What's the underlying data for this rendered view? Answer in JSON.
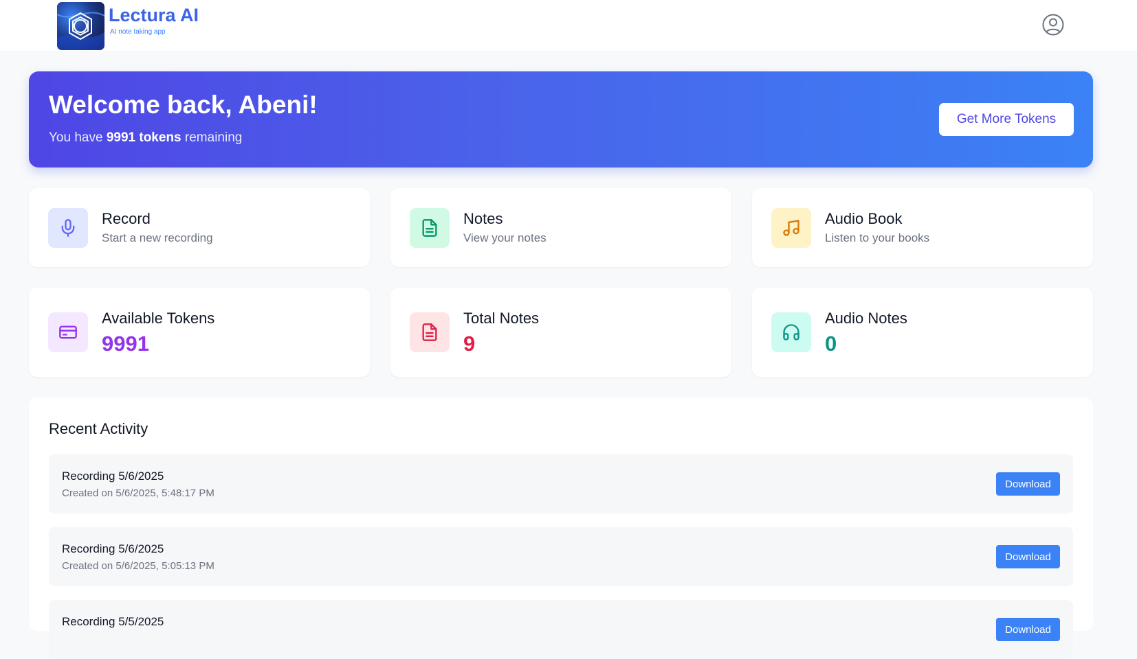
{
  "brand": {
    "name": "Lectura AI",
    "tagline": "AI note taking app"
  },
  "hero": {
    "title": "Welcome back, Abeni!",
    "sub_prefix": "You have ",
    "tokens_bold": "9991 tokens",
    "sub_suffix": " remaining",
    "button": "Get More Tokens"
  },
  "actions": [
    {
      "title": "Record",
      "subtitle": "Start a new recording",
      "icon": "microphone-icon",
      "color": "#6366f1",
      "bg": "#e0e7ff"
    },
    {
      "title": "Notes",
      "subtitle": "View your notes",
      "icon": "document-icon",
      "color": "#059669",
      "bg": "#d1fae5"
    },
    {
      "title": "Audio Book",
      "subtitle": "Listen to your books",
      "icon": "music-note-icon",
      "color": "#d97706",
      "bg": "#fef3c7"
    }
  ],
  "stats": [
    {
      "title": "Available Tokens",
      "value": "9991",
      "icon": "credit-card-icon",
      "color": "#9333ea",
      "bg": "#f3e8ff"
    },
    {
      "title": "Total Notes",
      "value": "9",
      "icon": "document-icon",
      "color": "#e11d48",
      "bg": "#ffe4e6"
    },
    {
      "title": "Audio Notes",
      "value": "0",
      "icon": "headphones-icon",
      "color": "#0d9488",
      "bg": "#ccfbf1"
    }
  ],
  "recent": {
    "title": "Recent Activity",
    "items": [
      {
        "title": "Recording 5/6/2025",
        "subtitle": "Created on 5/6/2025, 5:48:17 PM",
        "button": "Download"
      },
      {
        "title": "Recording 5/6/2025",
        "subtitle": "Created on 5/6/2025, 5:05:13 PM",
        "button": "Download"
      },
      {
        "title": "Recording 5/5/2025",
        "subtitle": "",
        "button": "Download"
      }
    ]
  }
}
